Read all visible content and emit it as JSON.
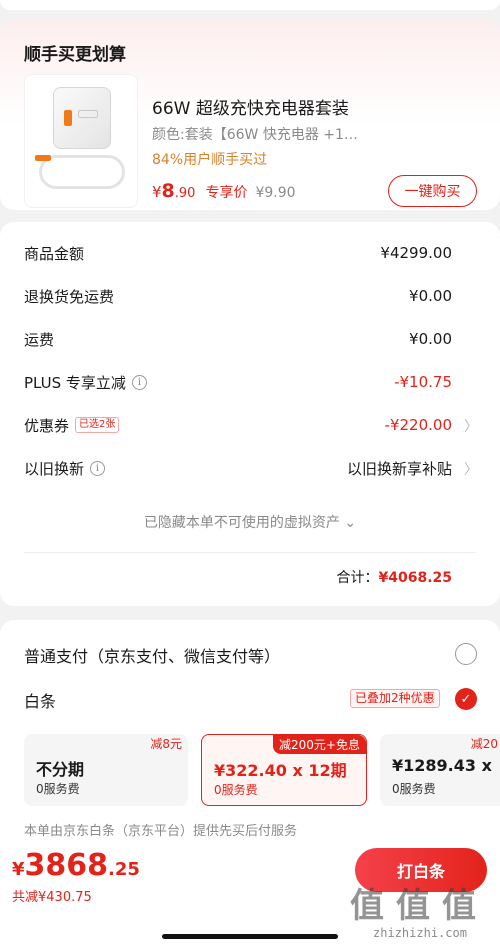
{
  "upsell": {
    "title": "顺手买更划算",
    "product_name": "66W 超级充快充电器套装",
    "spec": "颜色:套装【66W 快充电器 +1…",
    "users": "84%用户顺手买过",
    "price_yen": "¥",
    "price_int": "8",
    "price_dec": ".90",
    "price_tag": "专享价",
    "orig_price": "¥9.90",
    "buy_label": "一键购买"
  },
  "summary": {
    "rows": [
      {
        "label": "商品金额",
        "value": "¥4299.00"
      },
      {
        "label": "退换货免运费",
        "value": "¥0.00"
      },
      {
        "label": "运费",
        "value": "¥0.00"
      },
      {
        "label": "PLUS 专享立减",
        "value": "-¥10.75"
      },
      {
        "label": "优惠券",
        "badge": "已选2张",
        "value": "-¥220.00"
      },
      {
        "label": "以旧换新",
        "value": "以旧换新享补贴"
      }
    ],
    "hidden_assets": "已隐藏本单不可使用的虚拟资产",
    "total_label": "合计：",
    "total_amount": "¥4068.25"
  },
  "payment": {
    "normal_label": "普通支付（京东支付、微信支付等）",
    "baitiao_label": "白条",
    "stack_badge": "已叠加2种优惠",
    "plans": [
      {
        "tag": "减8元",
        "main": "不分期",
        "fee": "0服务费"
      },
      {
        "tag": "减200元+免息",
        "main": "¥322.40 x 12期",
        "fee": "0服务费"
      },
      {
        "tag": "减20",
        "main": "¥1289.43 x",
        "fee": "0服务费"
      }
    ],
    "service_note": "本单由京东白条（京东平台）提供先买后付服务"
  },
  "bottom": {
    "yen": "¥",
    "price_int": "3868",
    "price_dec": ".25",
    "saved": "共减¥430.75",
    "pay_label": "打白条"
  },
  "watermark": {
    "glyphs": [
      "值",
      "值",
      "值"
    ],
    "url": "zhizhizhi.com"
  },
  "colors": {
    "accent": "#e2231a",
    "orange": "#d9822b",
    "muted": "#8a8a8a"
  }
}
